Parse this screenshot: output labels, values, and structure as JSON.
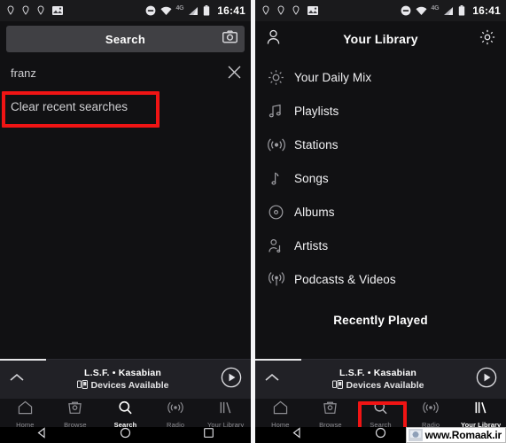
{
  "status_bar": {
    "icons": [
      "location-pin-icon",
      "location-pin-icon",
      "location-pin-icon",
      "photo-icon"
    ],
    "dnd_icon": "do-not-disturb-icon",
    "wifi_icon": "wifi-icon",
    "network_label": "4G",
    "signal_icon": "signal-icon",
    "battery_icon": "battery-icon",
    "time": "16:41"
  },
  "left_screen": {
    "search_bar": {
      "label": "Search",
      "placeholder": "Search",
      "camera_icon": "camera-icon"
    },
    "recent_searches": [
      {
        "query": "franz",
        "remove_icon": "close-icon"
      }
    ],
    "clear_label": "Clear recent searches",
    "highlight_color": "#f01414"
  },
  "right_screen": {
    "header": {
      "title": "Your Library",
      "profile_icon": "person-icon",
      "settings_icon": "gear-icon"
    },
    "library_items": [
      {
        "label": "Your Daily Mix",
        "icon": "sun-icon"
      },
      {
        "label": "Playlists",
        "icon": "music-notes-icon"
      },
      {
        "label": "Stations",
        "icon": "radio-waves-icon"
      },
      {
        "label": "Songs",
        "icon": "music-note-icon"
      },
      {
        "label": "Albums",
        "icon": "disc-icon"
      },
      {
        "label": "Artists",
        "icon": "artist-icon"
      },
      {
        "label": "Podcasts & Videos",
        "icon": "broadcast-icon"
      }
    ],
    "section_title": "Recently Played",
    "highlight_color": "#f01414"
  },
  "player": {
    "title": "L.S.F. • Kasabian",
    "subtitle": "Devices Available",
    "devices_icon": "devices-icon",
    "expand_icon": "chevron-up-icon",
    "play_icon": "play-icon",
    "progress_percent": 18
  },
  "tabs": [
    {
      "label": "Home",
      "icon": "home-icon"
    },
    {
      "label": "Browse",
      "icon": "browse-icon"
    },
    {
      "label": "Search",
      "icon": "search-icon"
    },
    {
      "label": "Radio",
      "icon": "radio-icon"
    },
    {
      "label": "Your Library",
      "icon": "library-icon"
    }
  ],
  "left_active_tab": 2,
  "right_active_tab": 4,
  "android_nav": {
    "back_icon": "back-triangle-icon",
    "home_icon": "home-circle-icon",
    "recents_icon": "recents-square-icon"
  },
  "watermark": {
    "text": "www.Romaak.ir",
    "icon": "globe-icon"
  }
}
